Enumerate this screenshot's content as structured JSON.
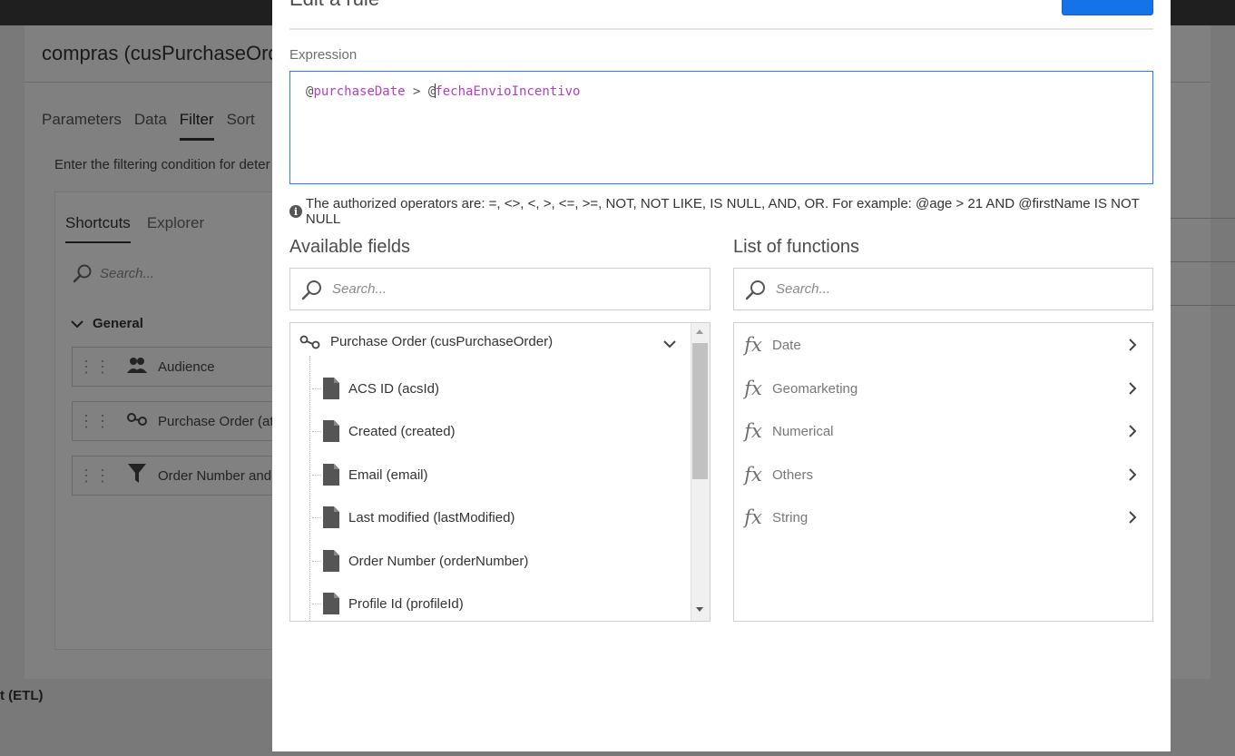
{
  "background": {
    "title": "compras (cusPurchaseOrd",
    "tabs": [
      "Parameters",
      "Data",
      "Filter",
      "Sort"
    ],
    "active_tab": "Filter",
    "instruction": "Enter the filtering condition for deter",
    "panel_tabs": [
      "Shortcuts",
      "Explorer"
    ],
    "search_placeholder": "Search...",
    "group": "General",
    "items": [
      "Audience",
      "Purchase Order (attr",
      "Order Number and"
    ],
    "bottom_fragment": "t (ETL)"
  },
  "modal": {
    "title": "Edit a rule",
    "expression_label": "Expression",
    "expression": {
      "part1_at": "@",
      "part1_field": "purchaseDate",
      "operator": " > ",
      "part2_at": "@",
      "part2_field": "fechaEnvioIncentivo"
    },
    "info_text": "The authorized operators are: =, <>, <, >, <=, >=, NOT, NOT LIKE, IS NULL, AND, OR. For example: @age > 21 AND @firstName IS NOT NULL",
    "available_fields": {
      "title": "Available fields",
      "search_placeholder": "Search...",
      "root": "Purchase Order (cusPurchaseOrder)",
      "fields": [
        "ACS ID (acsId)",
        "Created (created)",
        "Email (email)",
        "Last modified (lastModified)",
        "Order Number (orderNumber)",
        "Profile Id (profileId)"
      ]
    },
    "functions": {
      "title": "List of functions",
      "search_placeholder": "Search...",
      "items": [
        "Date",
        "Geomarketing",
        "Numerical",
        "Others",
        "String"
      ]
    }
  },
  "colors": {
    "accent": "#1473e6",
    "field_token": "#b23fc2",
    "focus_border": "#2680eb"
  }
}
